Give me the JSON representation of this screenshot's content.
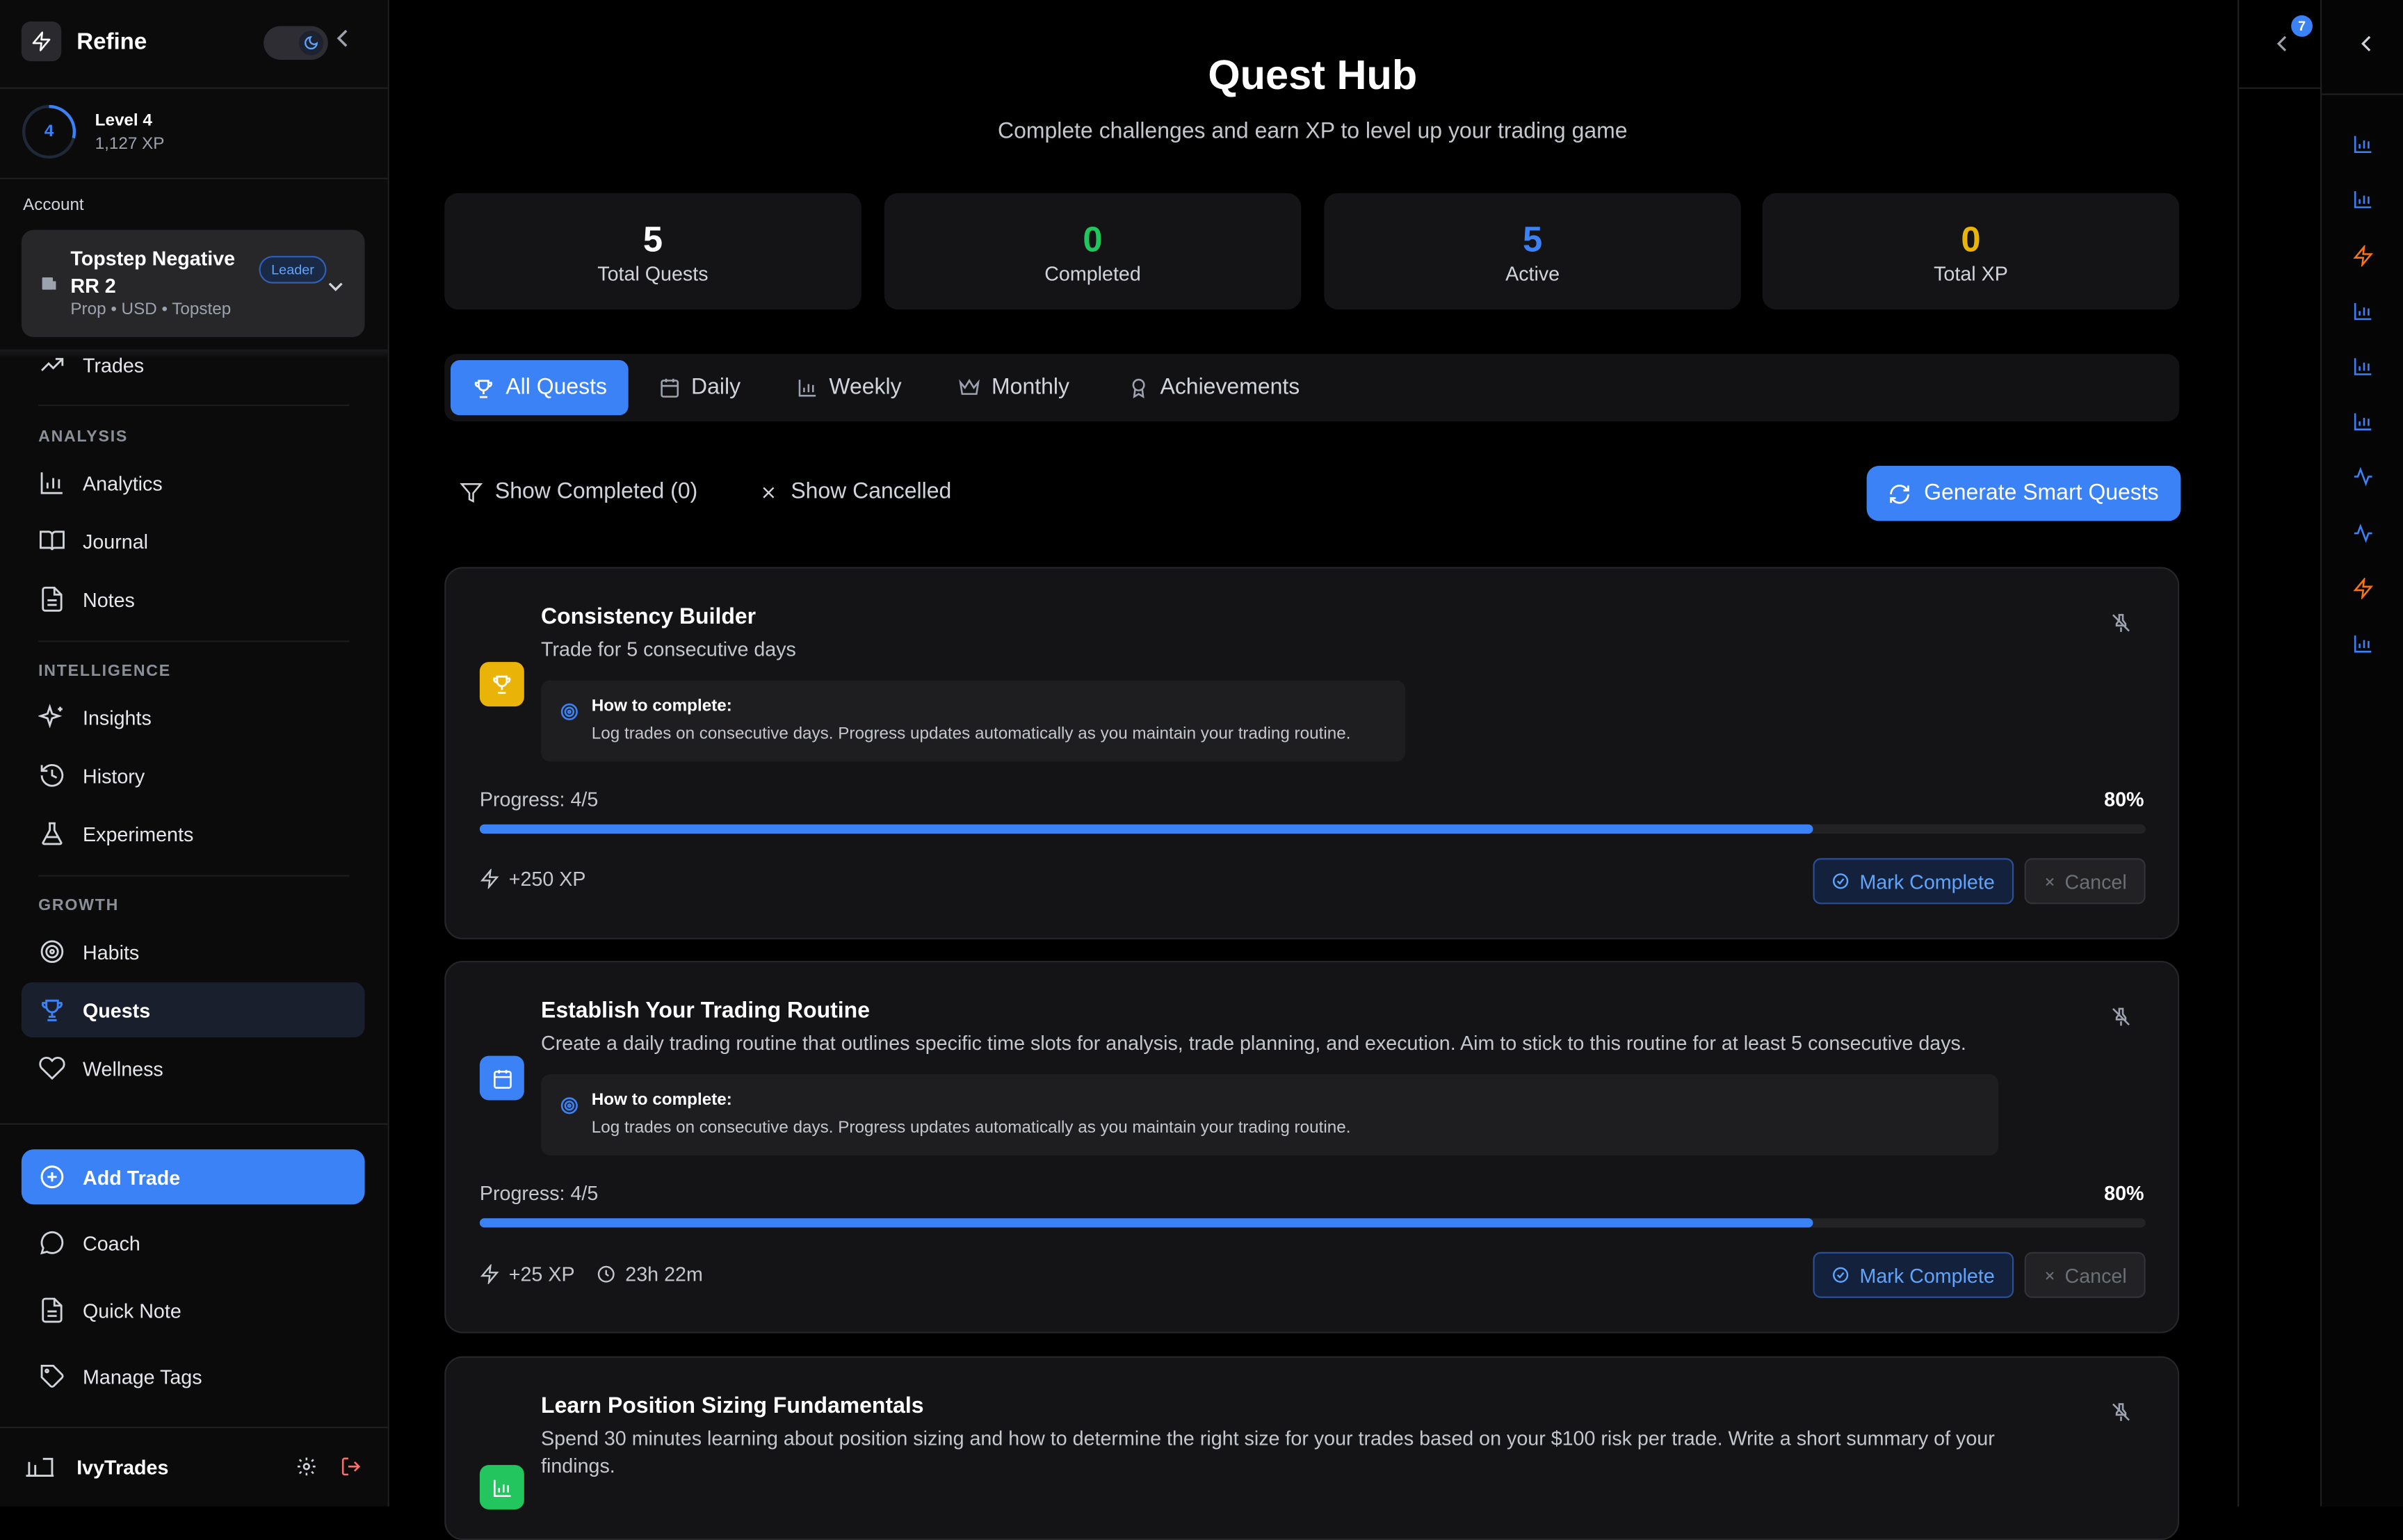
{
  "app": {
    "name": "Refine"
  },
  "level": {
    "num": "4",
    "title": "Level 4",
    "xp": "1,127 XP"
  },
  "account": {
    "label": "Account",
    "name": "Topstep Negative RR 2",
    "badge": "Leader",
    "meta": "Prop • USD • Topstep"
  },
  "nav": {
    "trades": "Trades",
    "analysis_label": "ANALYSIS",
    "analytics": "Analytics",
    "journal": "Journal",
    "notes": "Notes",
    "intelligence_label": "INTELLIGENCE",
    "insights": "Insights",
    "history": "History",
    "experiments": "Experiments",
    "growth_label": "GROWTH",
    "habits": "Habits",
    "quests": "Quests",
    "wellness": "Wellness",
    "add_trade": "Add Trade",
    "coach": "Coach",
    "quick_note": "Quick Note",
    "manage_tags": "Manage Tags"
  },
  "user": {
    "name": "IvyTrades"
  },
  "page": {
    "title": "Quest Hub",
    "subtitle": "Complete challenges and earn XP to level up your trading game"
  },
  "stats": [
    {
      "value": "5",
      "label": "Total Quests",
      "color": "#ffffff"
    },
    {
      "value": "0",
      "label": "Completed",
      "color": "#22c55e"
    },
    {
      "value": "5",
      "label": "Active",
      "color": "#3b82f6"
    },
    {
      "value": "0",
      "label": "Total XP",
      "color": "#eab308"
    }
  ],
  "tabs": {
    "all": "All Quests",
    "daily": "Daily",
    "weekly": "Weekly",
    "monthly": "Monthly",
    "achievements": "Achievements"
  },
  "filters": {
    "show_completed": "Show Completed (0)",
    "show_cancelled": "Show Cancelled",
    "generate": "Generate Smart Quests"
  },
  "quests": [
    {
      "title": "Consistency Builder",
      "desc": "Trade for 5 consecutive days",
      "how_title": "How to complete:",
      "how_text": "Log trades on consecutive days. Progress updates automatically as you maintain your trading routine.",
      "progress_label": "Progress: 4/5",
      "progress_pct": "80%",
      "progress": 0.8,
      "xp": "+250 XP",
      "mark": "Mark Complete",
      "cancel": "Cancel",
      "icon": "trophy-icon",
      "icon_color": "#eab308"
    },
    {
      "title": "Establish Your Trading Routine",
      "desc": "Create a daily trading routine that outlines specific time slots for analysis, trade planning, and execution. Aim to stick to this routine for at least 5 consecutive days.",
      "how_title": "How to complete:",
      "how_text": "Log trades on consecutive days. Progress updates automatically as you maintain your trading routine.",
      "progress_label": "Progress: 4/5",
      "progress_pct": "80%",
      "progress": 0.8,
      "xp": "+25 XP",
      "time": "23h 22m",
      "mark": "Mark Complete",
      "cancel": "Cancel",
      "icon": "calendar-icon",
      "icon_color": "#3b82f6"
    },
    {
      "title": "Learn Position Sizing Fundamentals",
      "desc": "Spend 30 minutes learning about position sizing and how to determine the right size for your trades based on your $100 risk per trade. Write a short summary of your findings.",
      "icon": "bar-chart-icon",
      "icon_color": "#22c55e"
    }
  ],
  "right_panel": {
    "badge": "7"
  }
}
